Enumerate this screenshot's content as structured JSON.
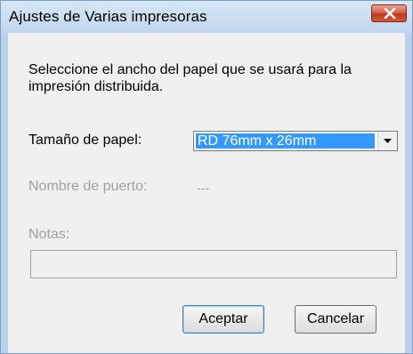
{
  "window": {
    "title": "Ajustes de Varias impresoras"
  },
  "dialog": {
    "instruction": "Seleccione el ancho del papel que se usará para la impresión distribuida.",
    "paper_size_label": "Tamaño de papel:",
    "paper_size_value": "RD 76mm x 26mm",
    "port_name_label": "Nombre de puerto:",
    "port_name_value": "---",
    "notes_label": "Notas:",
    "notes_value": "",
    "ok_button": "Aceptar",
    "cancel_button": "Cancelar"
  },
  "icons": {
    "close": "close-icon",
    "dropdown": "chevron-down-icon"
  },
  "colors": {
    "selection": "#3399ff",
    "close_button": "#c0391f",
    "disabled_text": "#a0a0a0"
  }
}
